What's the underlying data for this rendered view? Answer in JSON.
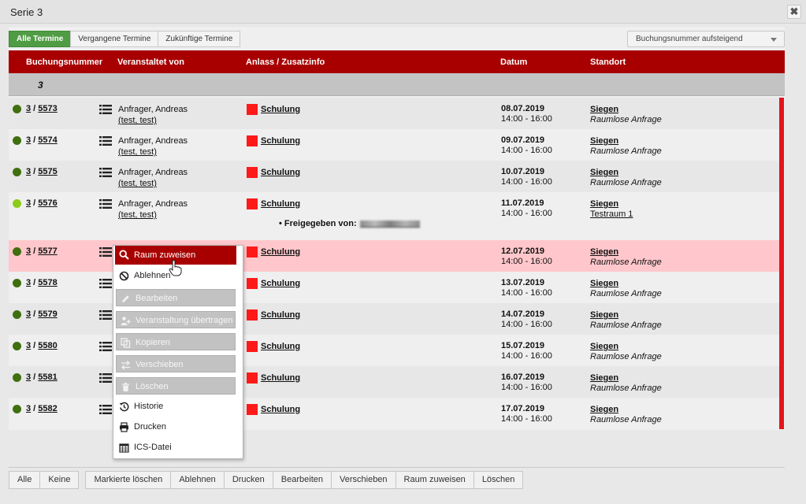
{
  "window": {
    "title": "Serie 3",
    "close_glyph": "✖"
  },
  "filters": [
    "Alle Termine",
    "Vergangene Termine",
    "Zukünftige Termine"
  ],
  "sort": {
    "label": "Buchungsnummer aufsteigend"
  },
  "columns": [
    "Buchungsnummer",
    "Veranstaltet von",
    "Anlass / Zusatzinfo",
    "Datum",
    "Standort"
  ],
  "group": {
    "label": "3"
  },
  "rows": [
    {
      "series": "3",
      "num": "5573",
      "org": "Anfrager, Andreas",
      "sub": "(test, test)",
      "anlass": "Schulung",
      "date": "08.07.2019",
      "time": "14:00 - 16:00",
      "city": "Siegen",
      "room": "Raumlose Anfrage"
    },
    {
      "series": "3",
      "num": "5574",
      "org": "Anfrager, Andreas",
      "sub": "(test, test)",
      "anlass": "Schulung",
      "date": "09.07.2019",
      "time": "14:00 - 16:00",
      "city": "Siegen",
      "room": "Raumlose Anfrage"
    },
    {
      "series": "3",
      "num": "5575",
      "org": "Anfrager, Andreas",
      "sub": "(test, test)",
      "anlass": "Schulung",
      "date": "10.07.2019",
      "time": "14:00 - 16:00",
      "city": "Siegen",
      "room": "Raumlose Anfrage"
    },
    {
      "series": "3",
      "num": "5576",
      "org": "Anfrager, Andreas",
      "sub": "(test, test)",
      "anlass": "Schulung",
      "date": "11.07.2019",
      "time": "14:00 - 16:00",
      "city": "Siegen",
      "room": "Testraum 1",
      "freigegeben": "Freigegeben von:"
    },
    {
      "series": "3",
      "num": "5577",
      "anlass": "Schulung",
      "date": "12.07.2019",
      "time": "14:00 - 16:00",
      "city": "Siegen",
      "room": "Raumlose Anfrage"
    },
    {
      "series": "3",
      "num": "5578",
      "anlass": "Schulung",
      "date": "13.07.2019",
      "time": "14:00 - 16:00",
      "city": "Siegen",
      "room": "Raumlose Anfrage"
    },
    {
      "series": "3",
      "num": "5579",
      "anlass": "Schulung",
      "date": "14.07.2019",
      "time": "14:00 - 16:00",
      "city": "Siegen",
      "room": "Raumlose Anfrage"
    },
    {
      "series": "3",
      "num": "5580",
      "anlass": "Schulung",
      "date": "15.07.2019",
      "time": "14:00 - 16:00",
      "city": "Siegen",
      "room": "Raumlose Anfrage"
    },
    {
      "series": "3",
      "num": "5581",
      "anlass": "Schulung",
      "date": "16.07.2019",
      "time": "14:00 - 16:00",
      "city": "Siegen",
      "room": "Raumlose Anfrage"
    },
    {
      "series": "3",
      "num": "5582",
      "anlass": "Schulung",
      "date": "17.07.2019",
      "time": "14:00 - 16:00",
      "city": "Siegen",
      "room": "Raumlose Anfrage"
    }
  ],
  "context_menu": [
    {
      "label": "Raum zuweisen",
      "icon": "search-icon",
      "state": "active"
    },
    {
      "label": "Ablehnen",
      "icon": "ban-icon",
      "state": "normal"
    },
    {
      "label": "Bearbeiten",
      "icon": "pencil-icon",
      "state": "disabled"
    },
    {
      "label": "Veranstaltung übertragen",
      "icon": "user-plus-icon",
      "state": "disabled"
    },
    {
      "label": "Kopieren",
      "icon": "copy-icon",
      "state": "disabled"
    },
    {
      "label": "Verschieben",
      "icon": "swap-icon",
      "state": "disabled"
    },
    {
      "label": "Löschen",
      "icon": "trash-icon",
      "state": "disabled"
    },
    {
      "label": "Historie",
      "icon": "history-icon",
      "state": "normal"
    },
    {
      "label": "Drucken",
      "icon": "printer-icon",
      "state": "normal"
    },
    {
      "label": "ICS-Datei",
      "icon": "calendar-icon",
      "state": "normal"
    }
  ],
  "bottom_buttons": {
    "select": [
      "Alle",
      "Keine"
    ],
    "actions": [
      "Markierte löschen",
      "Ablehnen",
      "Drucken",
      "Bearbeiten",
      "Verschieben",
      "Raum zuweisen",
      "Löschen"
    ]
  },
  "colors": {
    "header": "#a80000",
    "active_filter": "#4f9c44",
    "status_dark": "#3f6f0f",
    "status_light": "#8ccc18",
    "highlight_row": "#ffc7cb",
    "marker": "#ff1a1a"
  }
}
